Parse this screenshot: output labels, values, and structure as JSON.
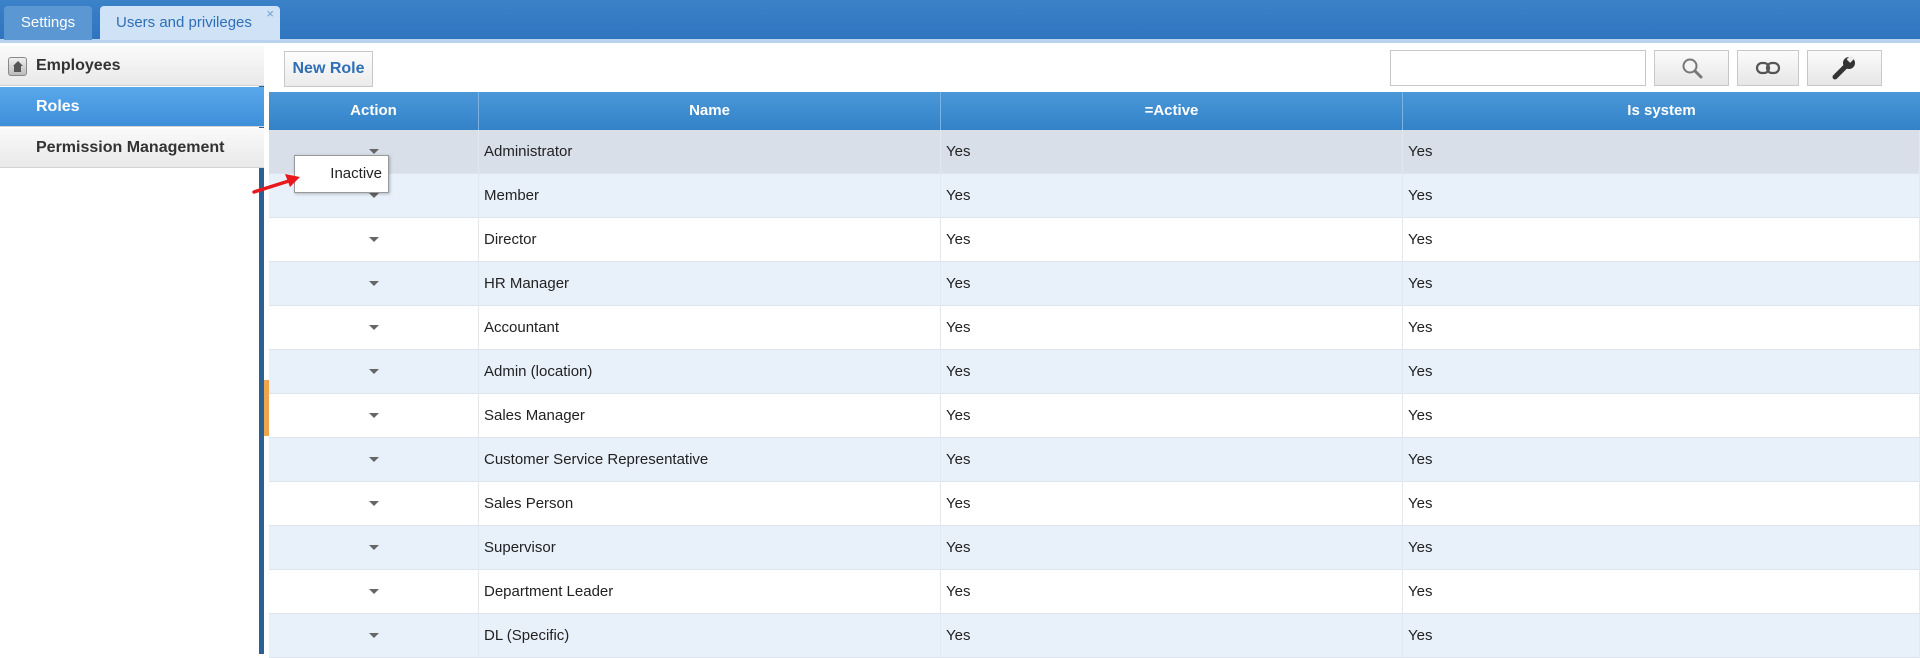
{
  "tabs": [
    {
      "label": "Settings"
    },
    {
      "label": "Users and privileges",
      "close": "×"
    }
  ],
  "sidebar": {
    "items": [
      {
        "label": "Employees",
        "icon": "home-icon"
      },
      {
        "label": "Roles"
      },
      {
        "label": "Permission Management"
      }
    ]
  },
  "toolbar": {
    "new_role_label": "New Role",
    "search_placeholder": ""
  },
  "table": {
    "columns": [
      "Action",
      "Name",
      "=Active",
      "Is system"
    ],
    "rows": [
      {
        "name": "Administrator",
        "active": "Yes",
        "system": "Yes"
      },
      {
        "name": "Member",
        "active": "Yes",
        "system": "Yes"
      },
      {
        "name": "Director",
        "active": "Yes",
        "system": "Yes"
      },
      {
        "name": "HR Manager",
        "active": "Yes",
        "system": "Yes"
      },
      {
        "name": "Accountant",
        "active": "Yes",
        "system": "Yes"
      },
      {
        "name": "Admin (location)",
        "active": "Yes",
        "system": "Yes"
      },
      {
        "name": "Sales Manager",
        "active": "Yes",
        "system": "Yes"
      },
      {
        "name": "Customer Service Representative",
        "active": "Yes",
        "system": "Yes"
      },
      {
        "name": "Sales Person",
        "active": "Yes",
        "system": "Yes"
      },
      {
        "name": "Supervisor",
        "active": "Yes",
        "system": "Yes"
      },
      {
        "name": "Department Leader",
        "active": "Yes",
        "system": "Yes"
      },
      {
        "name": "DL (Specific)",
        "active": "Yes",
        "system": "Yes"
      }
    ]
  },
  "popup": {
    "items": [
      "Inactive"
    ]
  },
  "colors": {
    "header_blue": "#3382c8",
    "selected_nav": "#3d8fd8",
    "annotation_red": "#e8191c"
  }
}
